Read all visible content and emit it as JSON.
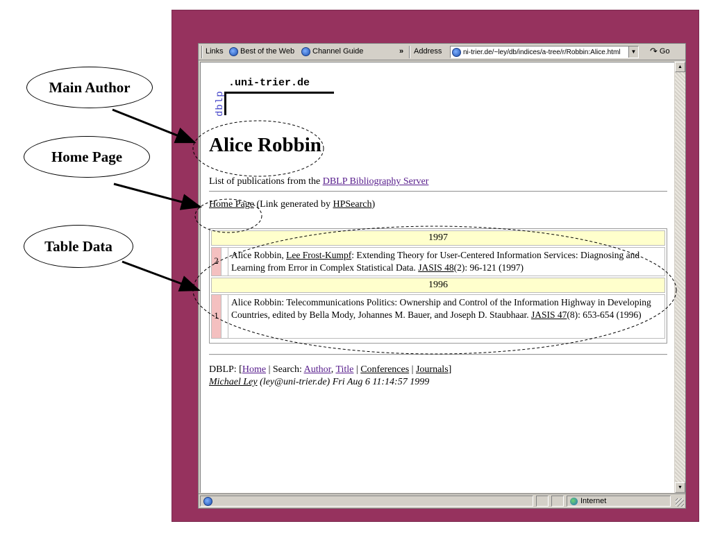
{
  "toolbar": {
    "links_label": "Links",
    "best_of_web": "Best of the Web",
    "channel_guide": "Channel Guide",
    "chevron": "»",
    "address_label": "Address",
    "url": "ni-trier.de/~ley/db/indices/a-tree/r/Robbin:Alice.html",
    "go_label": "Go"
  },
  "page": {
    "logo_vertical": "dblp",
    "logo_domain": ".uni-trier.de",
    "author_name": "Alice Robbin",
    "pub_list_prefix": "List of publications from the ",
    "pub_list_link": "DBLP Bibliography Server",
    "home_page_link": "Home Page",
    "home_page_mid": " (Link generated by ",
    "hpsearch_link": "HPSearch",
    "home_page_end": ")",
    "years": [
      "1997",
      "1996"
    ],
    "pubs": [
      {
        "num": "2",
        "author1": "Alice Robbin, ",
        "author2": "Lee Frost-Kumpf",
        "title": ": Extending Theory for User-Centered Information Services: Diagnosing and Learning from Error in Complex Statistical Data. ",
        "venue": "JASIS 48",
        "rest": "(2): 96-121 (1997)"
      },
      {
        "num": "1",
        "text": "Alice Robbin: Telecommunications Politics: Ownership and Control of the Information Highway in Developing Countries, edited by Bella Mody, Johannes M. Bauer, and Joseph D. Staubhaar. ",
        "venue": "JASIS 47",
        "rest": "(8): 653-654 (1996)"
      }
    ],
    "footer": {
      "prefix": "DBLP: [",
      "home": "Home",
      "search_label": " | Search: ",
      "author": "Author",
      "comma": ", ",
      "title": "Title",
      "sep1": " | ",
      "conferences": "Conferences",
      "sep2": " | ",
      "journals": "Journals",
      "suffix": "]",
      "maintainer": "Michael Ley",
      "email_date": " (ley@uni-trier.de) Fri Aug 6 11:14:57 1999"
    }
  },
  "status": {
    "zone": "Internet"
  },
  "annotations": {
    "main_author": "Main Author",
    "home_page": "Home Page",
    "table_data": "Table Data"
  },
  "colors": {
    "frame": "#96325e",
    "year_row": "#ffffcc",
    "num_cell": "#f4c0c0",
    "logo_blue": "#4646c8"
  }
}
